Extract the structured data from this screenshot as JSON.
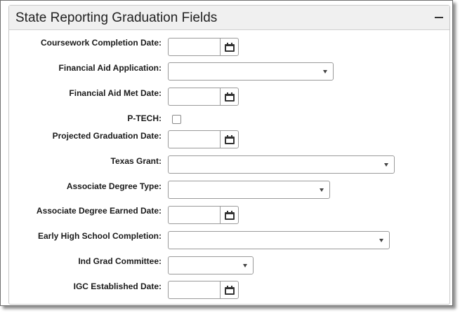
{
  "panel": {
    "title": "State Reporting Graduation Fields",
    "collapse_icon": "minus-icon"
  },
  "fields": {
    "coursework_completion_date": {
      "label": "Coursework Completion Date:",
      "value": ""
    },
    "financial_aid_application": {
      "label": "Financial Aid Application:",
      "value": ""
    },
    "financial_aid_met_date": {
      "label": "Financial Aid Met Date:",
      "value": ""
    },
    "p_tech": {
      "label": "P-TECH:",
      "checked": false
    },
    "projected_graduation_date": {
      "label": "Projected Graduation Date:",
      "value": ""
    },
    "texas_grant": {
      "label": "Texas Grant:",
      "value": ""
    },
    "associate_degree_type": {
      "label": "Associate Degree Type:",
      "value": ""
    },
    "associate_degree_earned_date": {
      "label": "Associate Degree Earned Date:",
      "value": ""
    },
    "early_high_school_completion": {
      "label": "Early High School Completion:",
      "value": ""
    },
    "ind_grad_committee": {
      "label": "Ind Grad Committee:",
      "value": ""
    },
    "igc_established_date": {
      "label": "IGC Established Date:",
      "value": ""
    }
  },
  "icons": {
    "date_picker": "calendar-icon",
    "dropdown": "chevron-down-icon"
  }
}
